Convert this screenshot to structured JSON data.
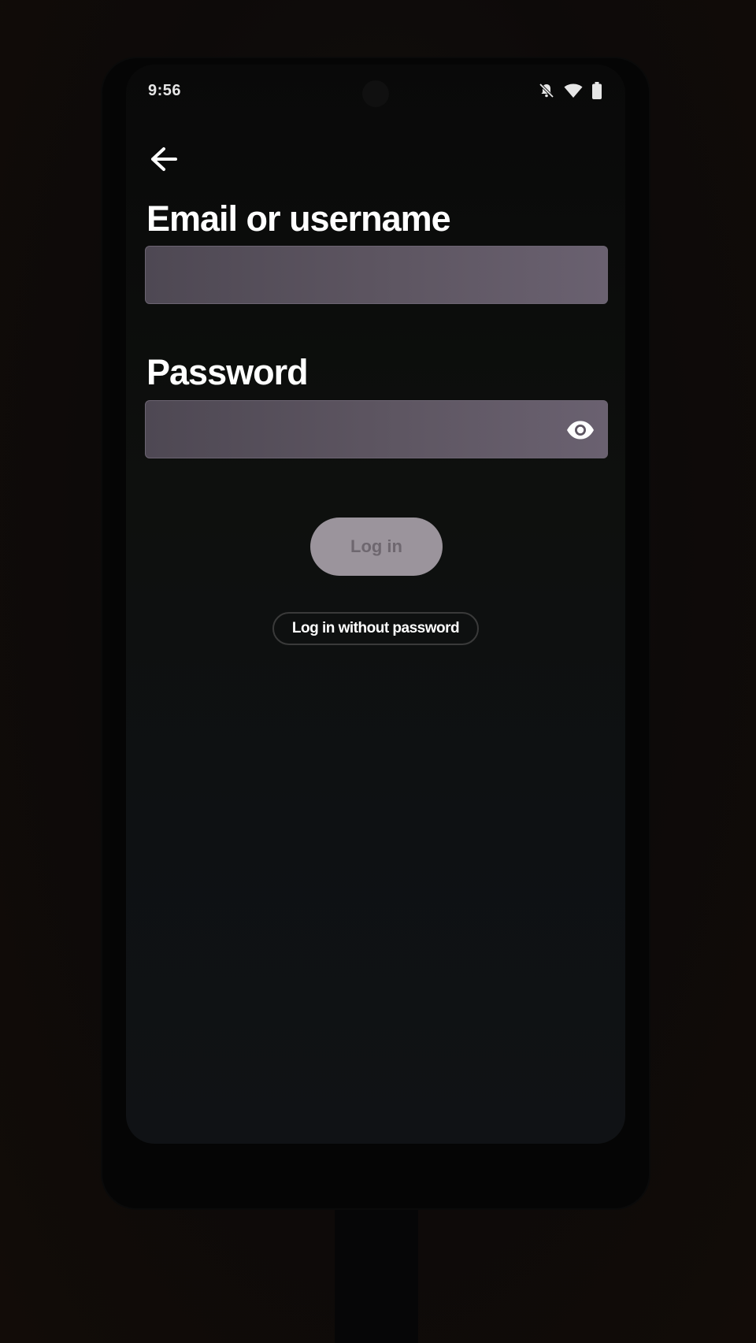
{
  "status_bar": {
    "time": "9:56",
    "icons": [
      "bell-off-icon",
      "wifi-icon",
      "battery-icon"
    ]
  },
  "navigation": {
    "back_icon": "arrow-left-icon"
  },
  "form": {
    "email_label": "Email or username",
    "email_value": "",
    "password_label": "Password",
    "password_value": "",
    "password_visibility_icon": "eye-icon"
  },
  "actions": {
    "login_label": "Log in",
    "login_without_password_label": "Log in without password"
  },
  "colors": {
    "background": "#090909",
    "field_fill": "#5e5662",
    "login_button_disabled": "#9b949c",
    "text_primary": "#ffffff"
  }
}
